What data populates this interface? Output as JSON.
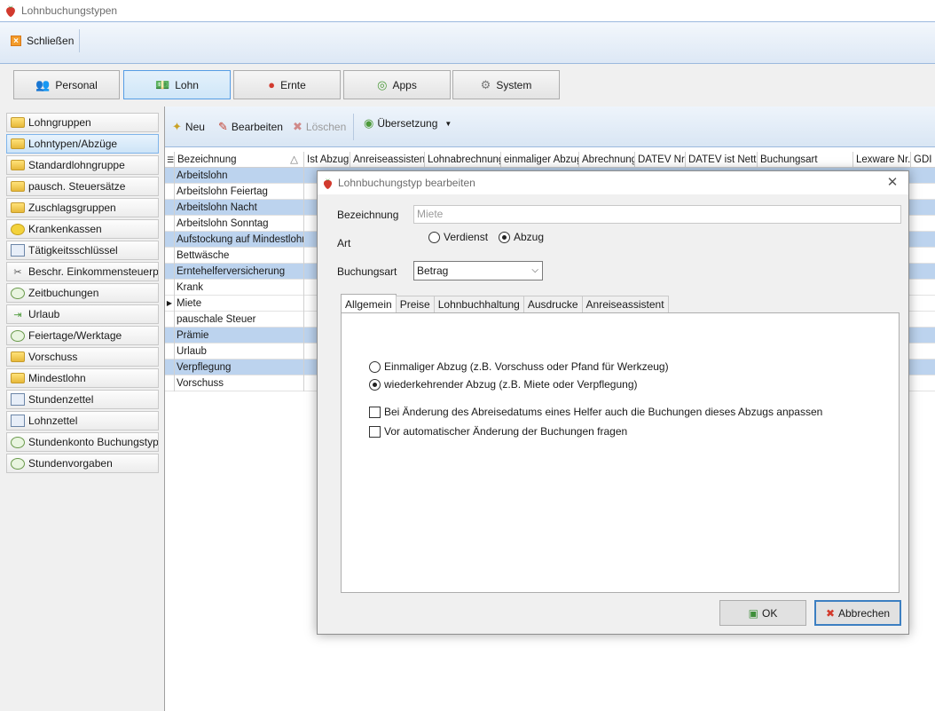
{
  "window": {
    "title": "Lohnbuchungstypen"
  },
  "ribbon": {
    "close_label": "Schließen"
  },
  "modules": [
    {
      "label": "Personal",
      "icon": "people-icon"
    },
    {
      "label": "Lohn",
      "icon": "money-icon"
    },
    {
      "label": "Ernte",
      "icon": "strawberry-icon"
    },
    {
      "label": "Apps",
      "icon": "apps-icon"
    },
    {
      "label": "System",
      "icon": "gear-icon"
    }
  ],
  "sidebar": {
    "items": [
      {
        "label": "Lohngruppen",
        "icon": "folder-icon"
      },
      {
        "label": "Lohntypen/Abzüge",
        "icon": "folder-icon"
      },
      {
        "label": "Standardlohngruppe",
        "icon": "folder-icon"
      },
      {
        "label": "pausch. Steuersätze",
        "icon": "folder-icon"
      },
      {
        "label": "Zuschlagsgruppen",
        "icon": "folder-icon"
      },
      {
        "label": "Krankenkassen",
        "icon": "smiley-icon"
      },
      {
        "label": "Tätigkeitsschlüssel",
        "icon": "document-icon"
      },
      {
        "label": "Beschr. Einkommensteuerpfl.",
        "icon": "scissors-icon"
      },
      {
        "label": "Zeitbuchungen",
        "icon": "clock-icon"
      },
      {
        "label": "Urlaub",
        "icon": "exit-icon"
      },
      {
        "label": "Feiertage/Werktage",
        "icon": "clock-icon"
      },
      {
        "label": "Vorschuss",
        "icon": "folder-icon"
      },
      {
        "label": "Mindestlohn",
        "icon": "folder-icon"
      },
      {
        "label": "Stundenzettel",
        "icon": "document-icon"
      },
      {
        "label": "Lohnzettel",
        "icon": "document-icon"
      },
      {
        "label": "Stundenkonto Buchungstypen",
        "icon": "clock-icon"
      },
      {
        "label": "Stundenvorgaben",
        "icon": "clock-icon"
      }
    ]
  },
  "toolbar": {
    "new_label": "Neu",
    "edit_label": "Bearbeiten",
    "delete_label": "Löschen",
    "translation_label": "Übersetzung"
  },
  "grid": {
    "columns": [
      "Bezeichnung",
      "Ist Abzug",
      "Anreiseassistent",
      "Lohnabrechnung",
      "einmaliger Abzug",
      "Abrechnung",
      "DATEV Nr.",
      "DATEV ist Netto",
      "Buchungsart",
      "Lexware Nr.",
      "GDI N"
    ],
    "sort_indicator": "△",
    "rows": [
      "Arbeitslohn",
      "Arbeitslohn Feiertag",
      "Arbeitslohn Nacht",
      "Arbeitslohn Sonntag",
      "Aufstockung auf Mindestlohn",
      "Bettwäsche",
      "Erntehelferversicherung",
      "Krank",
      "Miete",
      "pauschale Steuer",
      "Prämie",
      "Urlaub",
      "Verpflegung",
      "Vorschuss"
    ],
    "current_row_marker": "▶"
  },
  "dialog": {
    "title": "Lohnbuchungstyp bearbeiten",
    "close_glyph": "✕",
    "bezeichnung_label": "Bezeichnung",
    "bezeichnung_value": "Miete",
    "art_label": "Art",
    "art_options": [
      "Verdienst",
      "Abzug"
    ],
    "buchungsart_label": "Buchungsart",
    "buchungsart_value": "Betrag",
    "tabs": [
      "Allgemein",
      "Preise",
      "Lohnbuchhaltung",
      "Ausdrucke",
      "Anreiseassistent"
    ],
    "radio_once": "Einmaliger Abzug (z.B. Vorschuss oder Pfand für Werkzeug)",
    "radio_recurring": "wiederkehrender Abzug (z.B. Miete oder Verpflegung)",
    "check_adjust": "Bei Änderung des Abreisedatums eines Helfer auch die Buchungen dieses Abzugs anpassen",
    "check_ask": "Vor automatischer Änderung der Buchungen fragen",
    "ok_label": "OK",
    "cancel_label": "Abbrechen"
  }
}
